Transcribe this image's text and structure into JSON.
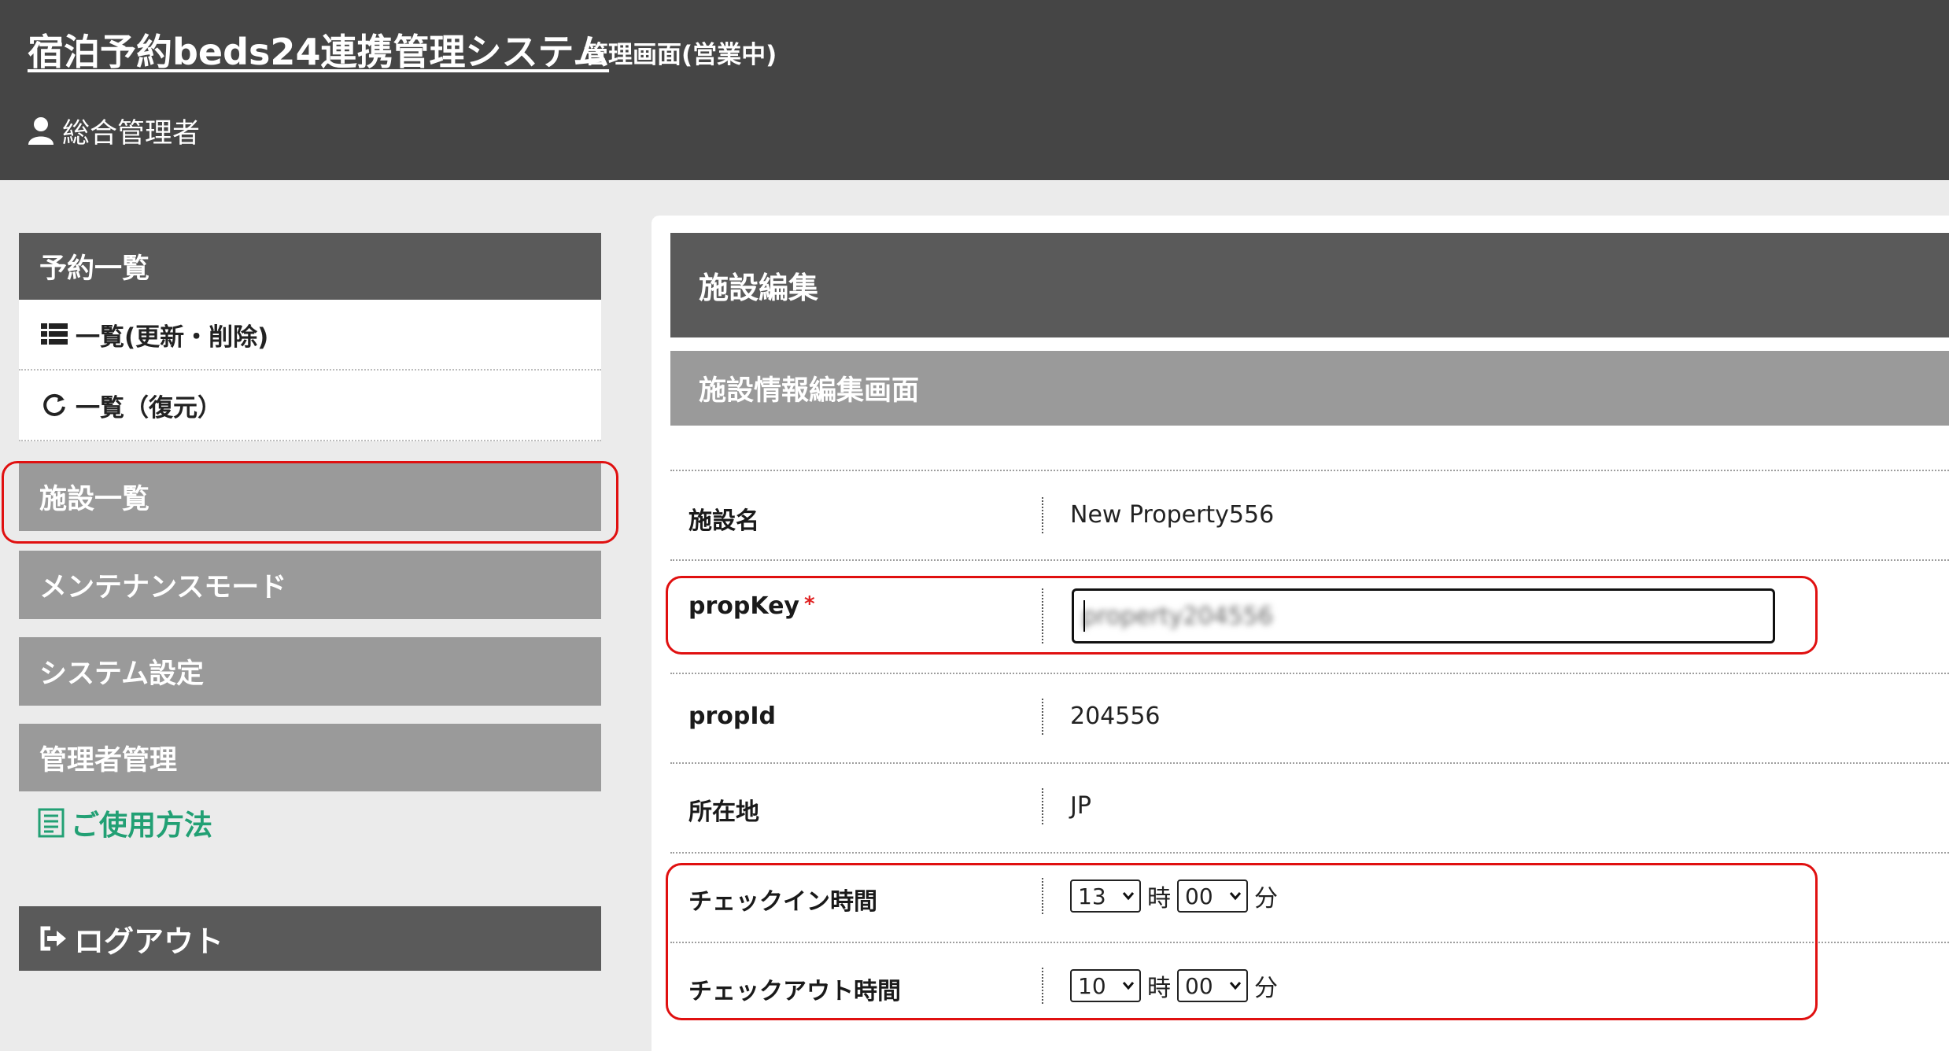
{
  "header": {
    "app_title": "宿泊予約beds24連携管理システム",
    "app_subtitle": "管理画面(営業中)",
    "user_name": "総合管理者"
  },
  "sidebar": {
    "reservations_header": "予約一覧",
    "reservation_items": [
      {
        "label": "一覧(更新・削除)",
        "icon": "list-icon"
      },
      {
        "label": "一覧（復元）",
        "icon": "refresh-icon"
      }
    ],
    "facility_list": "施設一覧",
    "maintenance_mode": "メンテナンスモード",
    "system_settings": "システム設定",
    "admin_management": "管理者管理",
    "help_link": "ご使用方法",
    "logout": "ログアウト"
  },
  "main": {
    "title": "施設編集",
    "subtitle": "施設情報編集画面",
    "fields": {
      "name": {
        "label": "施設名",
        "value": "New Property556"
      },
      "propkey": {
        "label": "propKey",
        "required_mark": "*",
        "value": "property204556"
      },
      "propid": {
        "label": "propId",
        "value": "204556"
      },
      "location": {
        "label": "所在地",
        "value": "JP"
      },
      "checkin": {
        "label": "チェックイン時間",
        "hour": "13",
        "minute": "00"
      },
      "checkout": {
        "label": "チェックアウト時間",
        "hour": "10",
        "minute": "00"
      },
      "hour_unit": "時",
      "minute_unit": "分"
    }
  },
  "colors": {
    "header_bg": "#454545",
    "dark_bar": "#5a5a5a",
    "mid_bar": "#9a9a9a",
    "highlight": "#e01010",
    "help_link": "#22a074"
  }
}
